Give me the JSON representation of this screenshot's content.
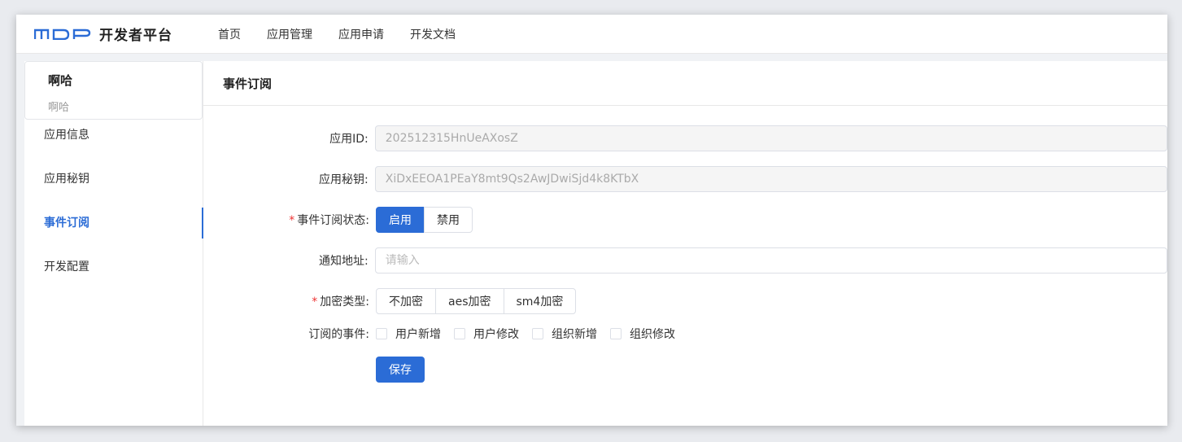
{
  "header": {
    "logo_text": "MDP",
    "title": "开发者平台",
    "nav": [
      "首页",
      "应用管理",
      "应用申请",
      "开发文档"
    ],
    "brand_color": "#2b6cd6"
  },
  "sidebar": {
    "app_name": "啊哈",
    "app_sub": "啊哈",
    "items": [
      {
        "label": "应用信息"
      },
      {
        "label": "应用秘钥"
      },
      {
        "label": "事件订阅"
      },
      {
        "label": "开发配置"
      }
    ],
    "active_index": 2
  },
  "main": {
    "title": "事件订阅",
    "form": {
      "app_id_label": "应用ID:",
      "app_id_value": "202512315HnUeAXosZ",
      "app_secret_label": "应用秘钥:",
      "app_secret_value": "XiDxEEOA1PEaY8mt9Qs2AwJDwiSjd4k8KTbX",
      "status_label": "事件订阅状态:",
      "status_options": [
        "启用",
        "禁用"
      ],
      "status_selected": "启用",
      "notify_label": "通知地址:",
      "notify_placeholder": "请输入",
      "notify_value": "",
      "encrypt_label": "加密类型:",
      "encrypt_options": [
        "不加密",
        "aes加密",
        "sm4加密"
      ],
      "events_label": "订阅的事件:",
      "events": [
        {
          "label": "用户新增",
          "checked": false
        },
        {
          "label": "用户修改",
          "checked": false
        },
        {
          "label": "组织新增",
          "checked": false
        },
        {
          "label": "组织修改",
          "checked": false
        }
      ],
      "save_label": "保存"
    }
  }
}
